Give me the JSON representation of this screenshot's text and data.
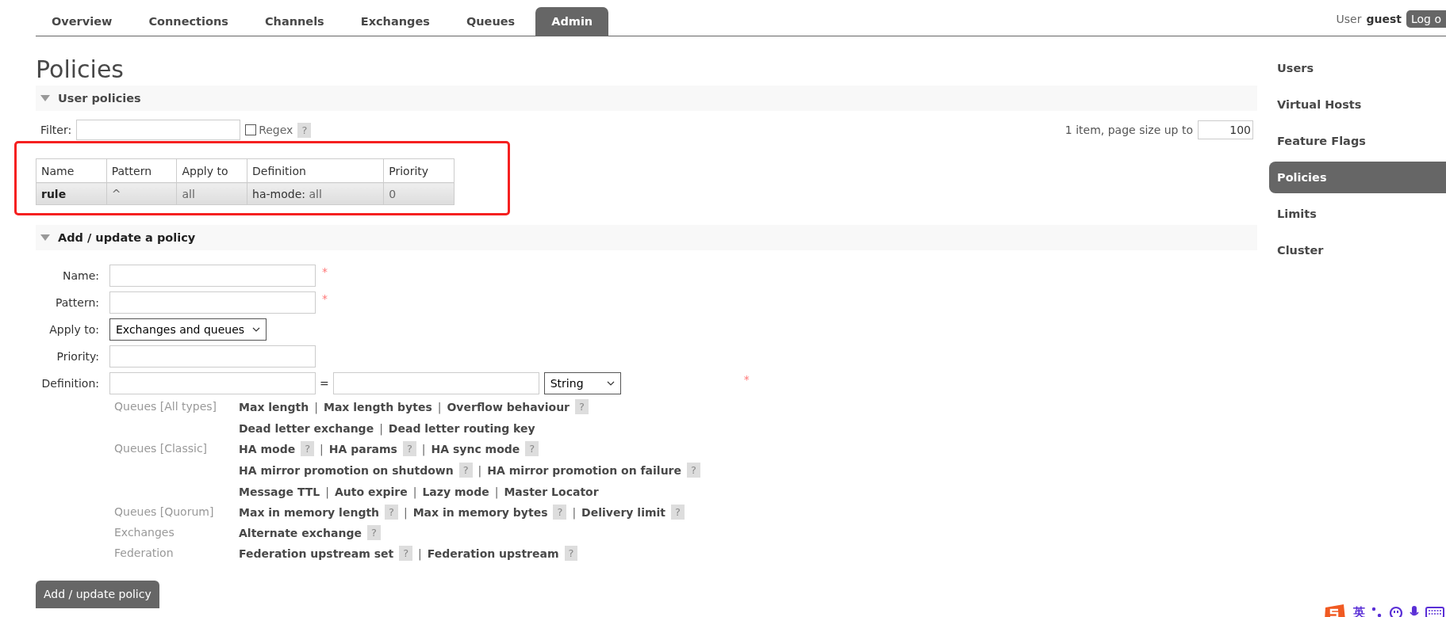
{
  "nav_tabs": [
    {
      "label": "Overview",
      "selected": false
    },
    {
      "label": "Connections",
      "selected": false
    },
    {
      "label": "Channels",
      "selected": false
    },
    {
      "label": "Exchanges",
      "selected": false
    },
    {
      "label": "Queues",
      "selected": false
    },
    {
      "label": "Admin",
      "selected": true
    }
  ],
  "user_bar": {
    "prefix": "User",
    "user": "guest",
    "logout_button": "Log o"
  },
  "page_title": "Policies",
  "user_policies": {
    "header": "User policies",
    "expanded": true,
    "filter_label": "Filter:",
    "regex": {
      "label": "Regex",
      "checked": false
    },
    "regex_help": "?",
    "count_text": "1 item, page size up to",
    "page_size": "100",
    "highlighted": true,
    "table": {
      "columns": [
        "Name",
        "Pattern",
        "Apply to",
        "Definition",
        "Priority"
      ],
      "rows": [
        {
          "name": "rule",
          "pattern": "^",
          "apply_to": "all",
          "definition": [
            {
              "key": "ha-mode:",
              "value": "all"
            }
          ],
          "priority": "0"
        }
      ]
    }
  },
  "add_policy": {
    "header": "Add / update a policy",
    "expanded": true,
    "fields": [
      {
        "kind": "text",
        "label": "Name:",
        "required_mark": "*"
      },
      {
        "kind": "text",
        "label": "Pattern:",
        "required_mark": "*"
      },
      {
        "kind": "select",
        "label": "Apply to:",
        "value": "Exchanges and queues"
      },
      {
        "kind": "text",
        "label": "Priority:"
      },
      {
        "kind": "definition",
        "label": "Definition:",
        "equals": "=",
        "type_value": "String",
        "required_mark": "*"
      }
    ],
    "help_groups": [
      {
        "category": "Queues [All types]",
        "lines": [
          [
            {
              "kind": "link",
              "text": "Max length"
            },
            {
              "kind": "sep",
              "text": "|"
            },
            {
              "kind": "link",
              "text": "Max length bytes"
            },
            {
              "kind": "sep",
              "text": "|"
            },
            {
              "kind": "link",
              "text": "Overflow behaviour"
            },
            {
              "kind": "help",
              "text": "?"
            }
          ],
          [
            {
              "kind": "link",
              "text": "Dead letter exchange"
            },
            {
              "kind": "sep",
              "text": "|"
            },
            {
              "kind": "link",
              "text": "Dead letter routing key"
            }
          ]
        ]
      },
      {
        "category": "Queues [Classic]",
        "lines": [
          [
            {
              "kind": "link",
              "text": "HA mode"
            },
            {
              "kind": "help",
              "text": "?"
            },
            {
              "kind": "sep",
              "text": "|"
            },
            {
              "kind": "link",
              "text": "HA params"
            },
            {
              "kind": "help",
              "text": "?"
            },
            {
              "kind": "sep",
              "text": "|"
            },
            {
              "kind": "link",
              "text": "HA sync mode"
            },
            {
              "kind": "help",
              "text": "?"
            }
          ],
          [
            {
              "kind": "link",
              "text": "HA mirror promotion on shutdown"
            },
            {
              "kind": "help",
              "text": "?"
            },
            {
              "kind": "sep",
              "text": "|"
            },
            {
              "kind": "link",
              "text": "HA mirror promotion on failure"
            },
            {
              "kind": "help",
              "text": "?"
            }
          ],
          [
            {
              "kind": "link",
              "text": "Message TTL"
            },
            {
              "kind": "sep",
              "text": "|"
            },
            {
              "kind": "link",
              "text": "Auto expire"
            },
            {
              "kind": "sep",
              "text": "|"
            },
            {
              "kind": "link",
              "text": "Lazy mode"
            },
            {
              "kind": "sep",
              "text": "|"
            },
            {
              "kind": "link",
              "text": "Master Locator"
            }
          ]
        ]
      },
      {
        "category": "Queues [Quorum]",
        "lines": [
          [
            {
              "kind": "link",
              "text": "Max in memory length"
            },
            {
              "kind": "help",
              "text": "?"
            },
            {
              "kind": "sep",
              "text": "|"
            },
            {
              "kind": "link",
              "text": "Max in memory bytes"
            },
            {
              "kind": "help",
              "text": "?"
            },
            {
              "kind": "sep",
              "text": "|"
            },
            {
              "kind": "link",
              "text": "Delivery limit"
            },
            {
              "kind": "help",
              "text": "?"
            }
          ]
        ]
      },
      {
        "category": "Exchanges",
        "lines": [
          [
            {
              "kind": "link",
              "text": "Alternate exchange"
            },
            {
              "kind": "help",
              "text": "?"
            }
          ]
        ]
      },
      {
        "category": "Federation",
        "lines": [
          [
            {
              "kind": "link",
              "text": "Federation upstream set"
            },
            {
              "kind": "help",
              "text": "?"
            },
            {
              "kind": "sep",
              "text": "|"
            },
            {
              "kind": "link",
              "text": "Federation upstream"
            },
            {
              "kind": "help",
              "text": "?"
            }
          ]
        ]
      }
    ],
    "submit_button": "Add / update policy"
  },
  "sidebar": {
    "items": [
      {
        "label": "Users",
        "selected": false
      },
      {
        "label": "Virtual Hosts",
        "selected": false
      },
      {
        "label": "Feature Flags",
        "selected": false
      },
      {
        "label": "Policies",
        "selected": true
      },
      {
        "label": "Limits",
        "selected": false
      },
      {
        "label": "Cluster",
        "selected": false
      }
    ]
  },
  "ime_toolbar": {
    "language": "英"
  }
}
